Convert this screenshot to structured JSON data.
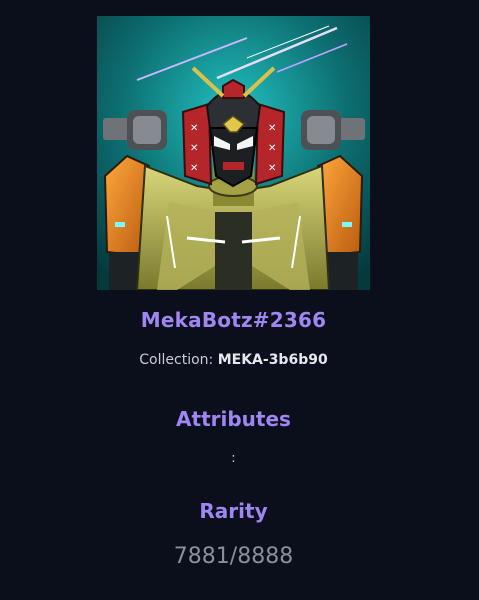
{
  "nft": {
    "name": "MekaBotz#2366",
    "image_alt": "mech-robot-artwork"
  },
  "collection": {
    "label": "Collection:",
    "value": "MEKA-3b6b90"
  },
  "attributes": {
    "heading": "Attributes",
    "separator": ":"
  },
  "rarity": {
    "heading": "Rarity",
    "value": "7881/8888"
  },
  "colors": {
    "background": "#0b0f1c",
    "accent": "#9f86f2",
    "muted": "#8b8f99",
    "image_bg": "#0f8a8a"
  }
}
